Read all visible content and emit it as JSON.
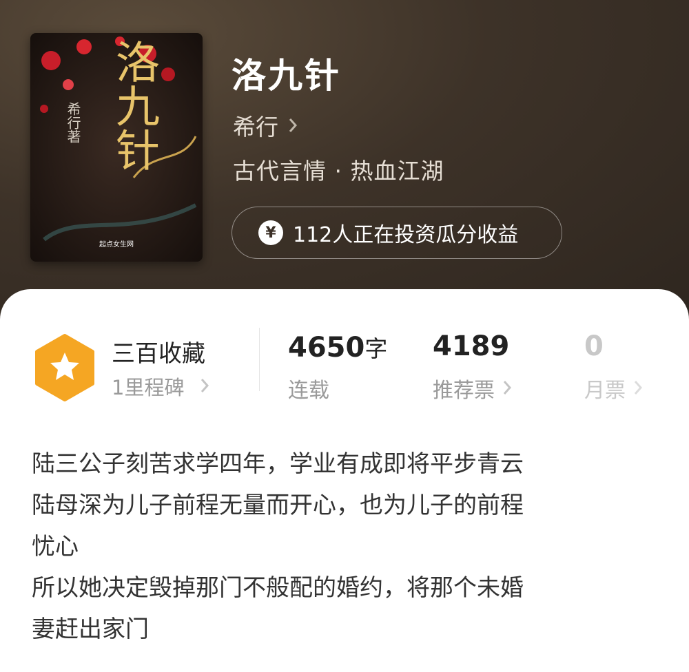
{
  "book": {
    "title": "洛九针",
    "author": "希行",
    "genre": "古代言情 · 热血江湖",
    "invest_text": "112人正在投资瓜分收益"
  },
  "cover": {
    "title_art": "洛九针",
    "author_art": "希行著",
    "publisher_mark": "起点女生网"
  },
  "stats": {
    "milestone_title": "三百收藏",
    "milestone_sub": "1里程碑",
    "words_value": "4650",
    "words_unit": "字",
    "words_label": "连载",
    "recommend_value": "4189",
    "recommend_label": "推荐票",
    "monthly_value": "0",
    "monthly_label": "月票"
  },
  "description": [
    "陆三公子刻苦求学四年，学业有成即将平步青云",
    "陆母深为儿子前程无量而开心，也为儿子的前程",
    "忧心",
    "所以她决定毁掉那门不般配的婚约，将那个未婚",
    "妻赶出家门"
  ],
  "icons": {
    "badge": "star-hexagon-icon",
    "chevron": "chevron-right-icon",
    "yen": "yen-coin-icon"
  },
  "colors": {
    "hero_bg": "#3d3228",
    "badge_orange": "#f5a623",
    "text_dark": "#222222",
    "text_gray": "#9a9a9a"
  }
}
